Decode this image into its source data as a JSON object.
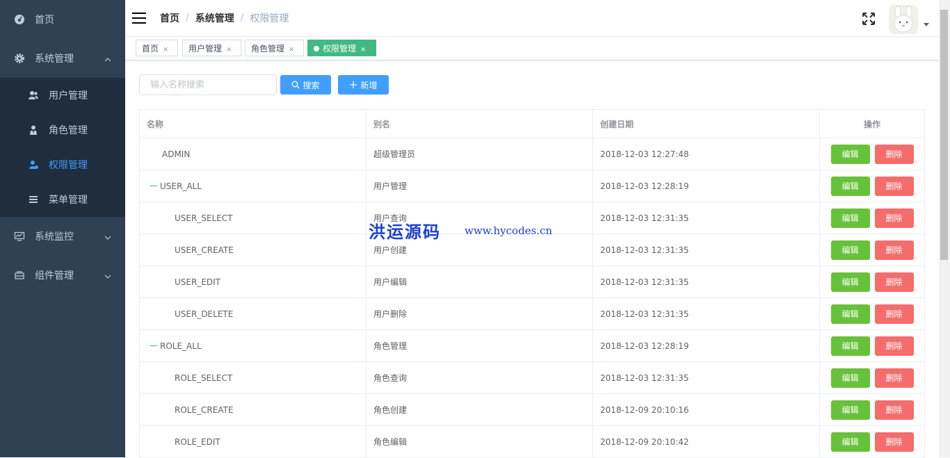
{
  "sidebar": {
    "items": [
      {
        "label": "首页",
        "icon": "dashboard-icon"
      },
      {
        "label": "系统管理",
        "icon": "gear-icon",
        "expanded": true,
        "children": [
          {
            "label": "用户管理",
            "icon": "user-icon"
          },
          {
            "label": "角色管理",
            "icon": "role-icon"
          },
          {
            "label": "权限管理",
            "icon": "permission-icon",
            "active": true
          },
          {
            "label": "菜单管理",
            "icon": "menu-icon"
          }
        ]
      },
      {
        "label": "系统监控",
        "icon": "monitor-icon"
      },
      {
        "label": "组件管理",
        "icon": "component-icon"
      }
    ]
  },
  "breadcrumb": [
    "首页",
    "系统管理",
    "权限管理"
  ],
  "tags": [
    {
      "label": "首页",
      "close": "×"
    },
    {
      "label": "用户管理",
      "close": "×"
    },
    {
      "label": "角色管理",
      "close": "×"
    },
    {
      "label": "权限管理",
      "close": "×",
      "active": true
    }
  ],
  "toolbar": {
    "search_placeholder": "输入名称搜索",
    "search_label": "搜索",
    "add_label": "新增"
  },
  "table": {
    "columns": [
      "名称",
      "别名",
      "创建日期",
      "操作"
    ],
    "rows": [
      {
        "name": "ADMIN",
        "alias": "超级管理员",
        "date": "2018-12-03 12:27:48",
        "level": "root"
      },
      {
        "name": "USER_ALL",
        "alias": "用户管理",
        "date": "2018-12-03 12:28:19",
        "level": "parent"
      },
      {
        "name": "USER_SELECT",
        "alias": "用户查询",
        "date": "2018-12-03 12:31:35",
        "level": "child"
      },
      {
        "name": "USER_CREATE",
        "alias": "用户创建",
        "date": "2018-12-03 12:31:35",
        "level": "child"
      },
      {
        "name": "USER_EDIT",
        "alias": "用户编辑",
        "date": "2018-12-03 12:31:35",
        "level": "child"
      },
      {
        "name": "USER_DELETE",
        "alias": "用户删除",
        "date": "2018-12-03 12:31:35",
        "level": "child"
      },
      {
        "name": "ROLE_ALL",
        "alias": "角色管理",
        "date": "2018-12-03 12:28:19",
        "level": "parent"
      },
      {
        "name": "ROLE_SELECT",
        "alias": "角色查询",
        "date": "2018-12-03 12:31:35",
        "level": "child"
      },
      {
        "name": "ROLE_CREATE",
        "alias": "角色创建",
        "date": "2018-12-09 20:10:16",
        "level": "child"
      },
      {
        "name": "ROLE_EDIT",
        "alias": "角色编辑",
        "date": "2018-12-09 20:10:42",
        "level": "child"
      }
    ],
    "edit_label": "编辑",
    "delete_label": "删除"
  },
  "watermark": {
    "cn": "洪运源码",
    "url": "www.hycodes.cn"
  },
  "colors": {
    "sidebar": "#304156",
    "submenu": "#1f2d3d",
    "primary": "#409eff",
    "success": "#67c23a",
    "danger": "#f56c6c",
    "tag_active": "#42b983"
  }
}
